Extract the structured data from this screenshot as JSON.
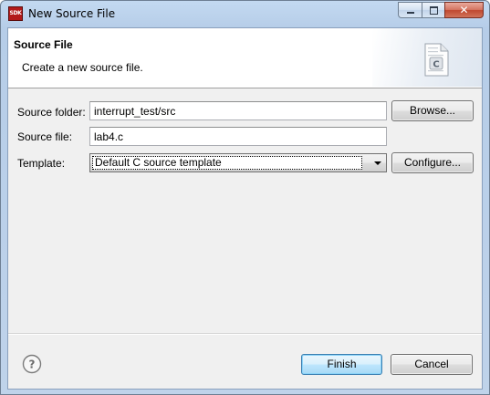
{
  "window": {
    "title": "New Source File",
    "app_icon_text": "SDK"
  },
  "banner": {
    "title": "Source File",
    "description": "Create a new source file.",
    "icon_letter": "C",
    "icon": "c-source-file-icon"
  },
  "form": {
    "source_folder_label": "Source folder:",
    "source_folder_value": "interrupt_test/src",
    "browse_label": "Browse...",
    "source_file_label": "Source file:",
    "source_file_value": "lab4.c",
    "template_label": "Template:",
    "template_selected": "Default C source template",
    "configure_label": "Configure..."
  },
  "footer": {
    "help_icon": "question-mark-icon",
    "finish_label": "Finish",
    "cancel_label": "Cancel"
  },
  "colors": {
    "title_bar": "#bfd3ea",
    "close_button": "#c0482f",
    "dialog_background": "#f0f0f0",
    "banner_background": "#ffffff",
    "default_button_border": "#3c7fb1"
  }
}
